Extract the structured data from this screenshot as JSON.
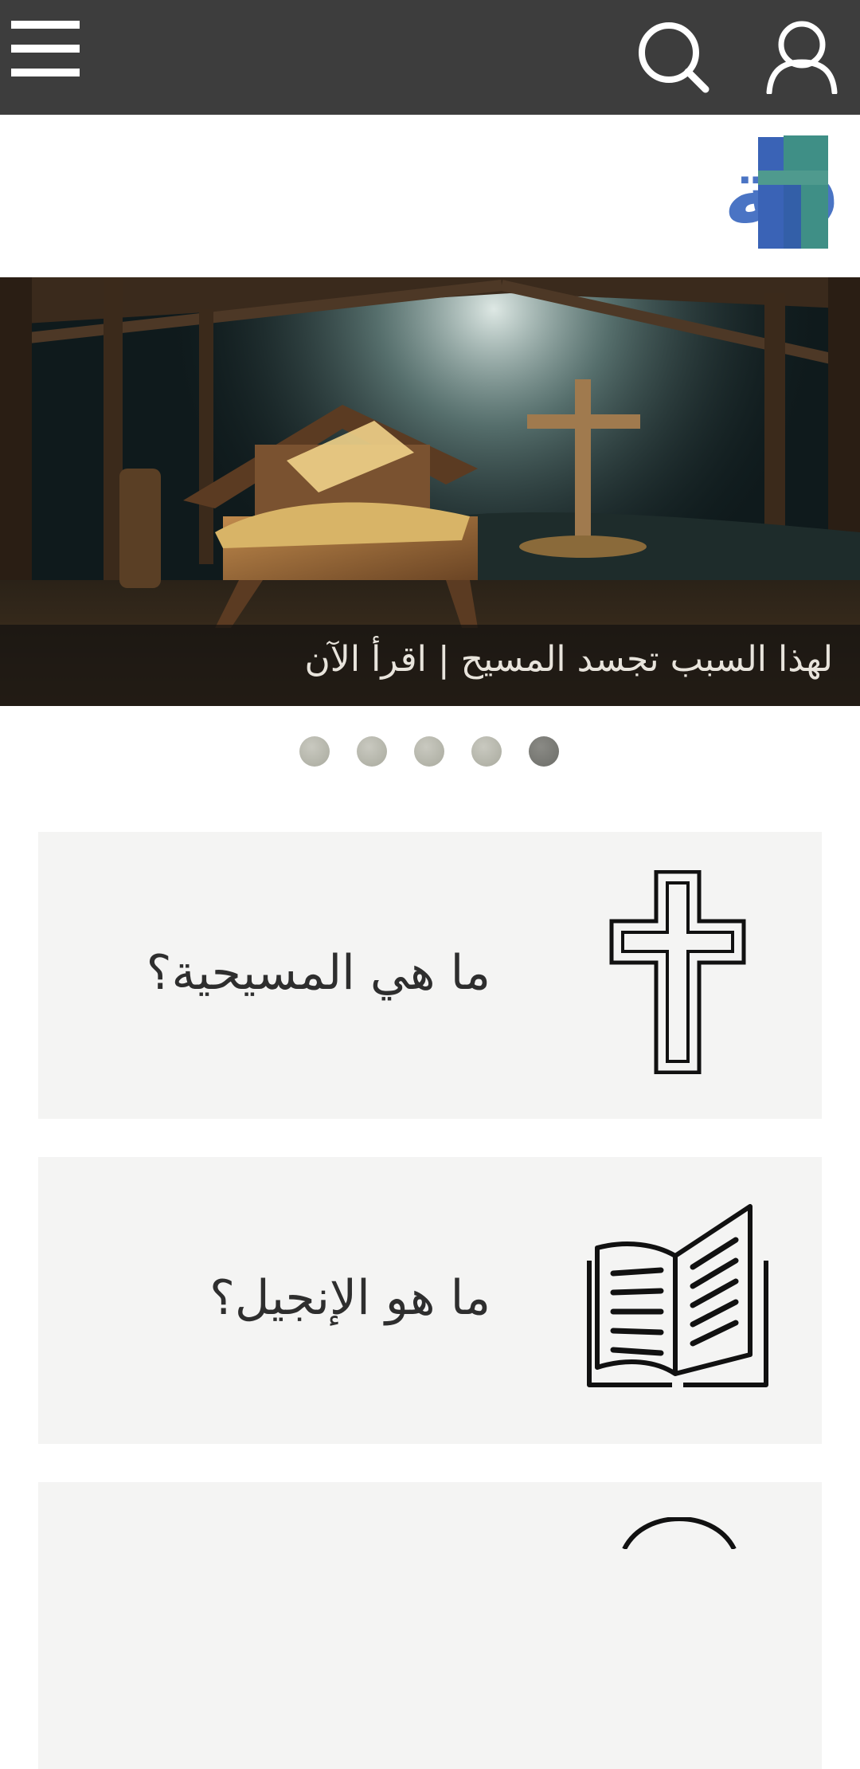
{
  "header": {
    "menu_icon": "hamburger-menu-icon",
    "search_icon": "search-icon",
    "user_icon": "user-icon",
    "logo_text": "معرفة",
    "logo_icon": "cross-logo-icon"
  },
  "hero": {
    "image": "manger-with-cross-in-barn",
    "caption": "لهذا السبب تجسد المسيح | اقرأ الآن",
    "slide_count": 5,
    "active_slide_index": 4
  },
  "cards": [
    {
      "title": "ما هي المسيحية؟",
      "icon": "cross-icon"
    },
    {
      "title": "ما هو الإنجيل؟",
      "icon": "open-book-icon"
    },
    {
      "title": "",
      "icon": "partial-circle-icon"
    }
  ],
  "colors": {
    "topbar": "#3d3d3d",
    "card_background": "#f4f4f3",
    "logo_blue": "#4a74c4",
    "logo_teal": "#3f8f86"
  }
}
